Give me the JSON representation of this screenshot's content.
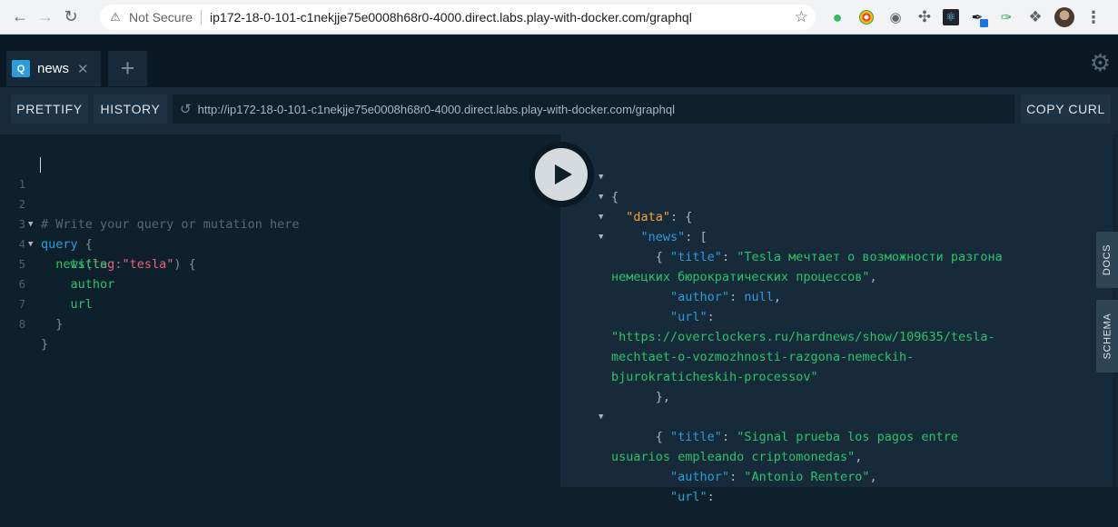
{
  "browser": {
    "security_label": "Not Secure",
    "url": "ip172-18-0-101-c1nekjje75e0008h68r0-4000.direct.labs.play-with-docker.com/graphql"
  },
  "tabs": [
    {
      "badge": "Q",
      "label": "news"
    }
  ],
  "toolbar": {
    "prettify_label": "PRETTIFY",
    "history_label": "HISTORY",
    "endpoint_url": "http://ip172-18-0-101-c1nekjje75e0008h68r0-4000.direct.labs.play-with-docker.com/graphql",
    "copy_curl_label": "COPY CURL"
  },
  "editor": {
    "line_numbers": [
      "1",
      "2",
      "3",
      "4",
      "5",
      "6",
      "7",
      "8"
    ],
    "comment": "# Write your query or mutation here",
    "query_kw": "query",
    "field_news": "news",
    "arg_name": "tag",
    "arg_value": "\"tesla\"",
    "field_title": "title",
    "field_author": "author",
    "field_url": "url"
  },
  "results": {
    "key_data": "\"data\"",
    "key_news": "\"news\"",
    "key_title": "\"title\"",
    "key_author": "\"author\"",
    "key_url": "\"url\"",
    "item1_title_a": "\"Tesla мечтает о возможности разгона",
    "item1_title_b": "немецких бюрократических процессов\"",
    "item1_author": "null",
    "item1_url_a": "\"https://overclockers.ru/hardnews/show/109635/tesla-",
    "item1_url_b": "mechtaet-o-vozmozhnosti-razgona-nemeckih-",
    "item1_url_c": "bjurokraticheskih-processov\"",
    "item2_title_a": "\"Signal prueba los pagos entre",
    "item2_title_b": "usuarios empleando criptomonedas\"",
    "item2_author": "\"Antonio Rentero\""
  },
  "side_tabs": {
    "docs": "DOCS",
    "schema": "SCHEMA"
  }
}
